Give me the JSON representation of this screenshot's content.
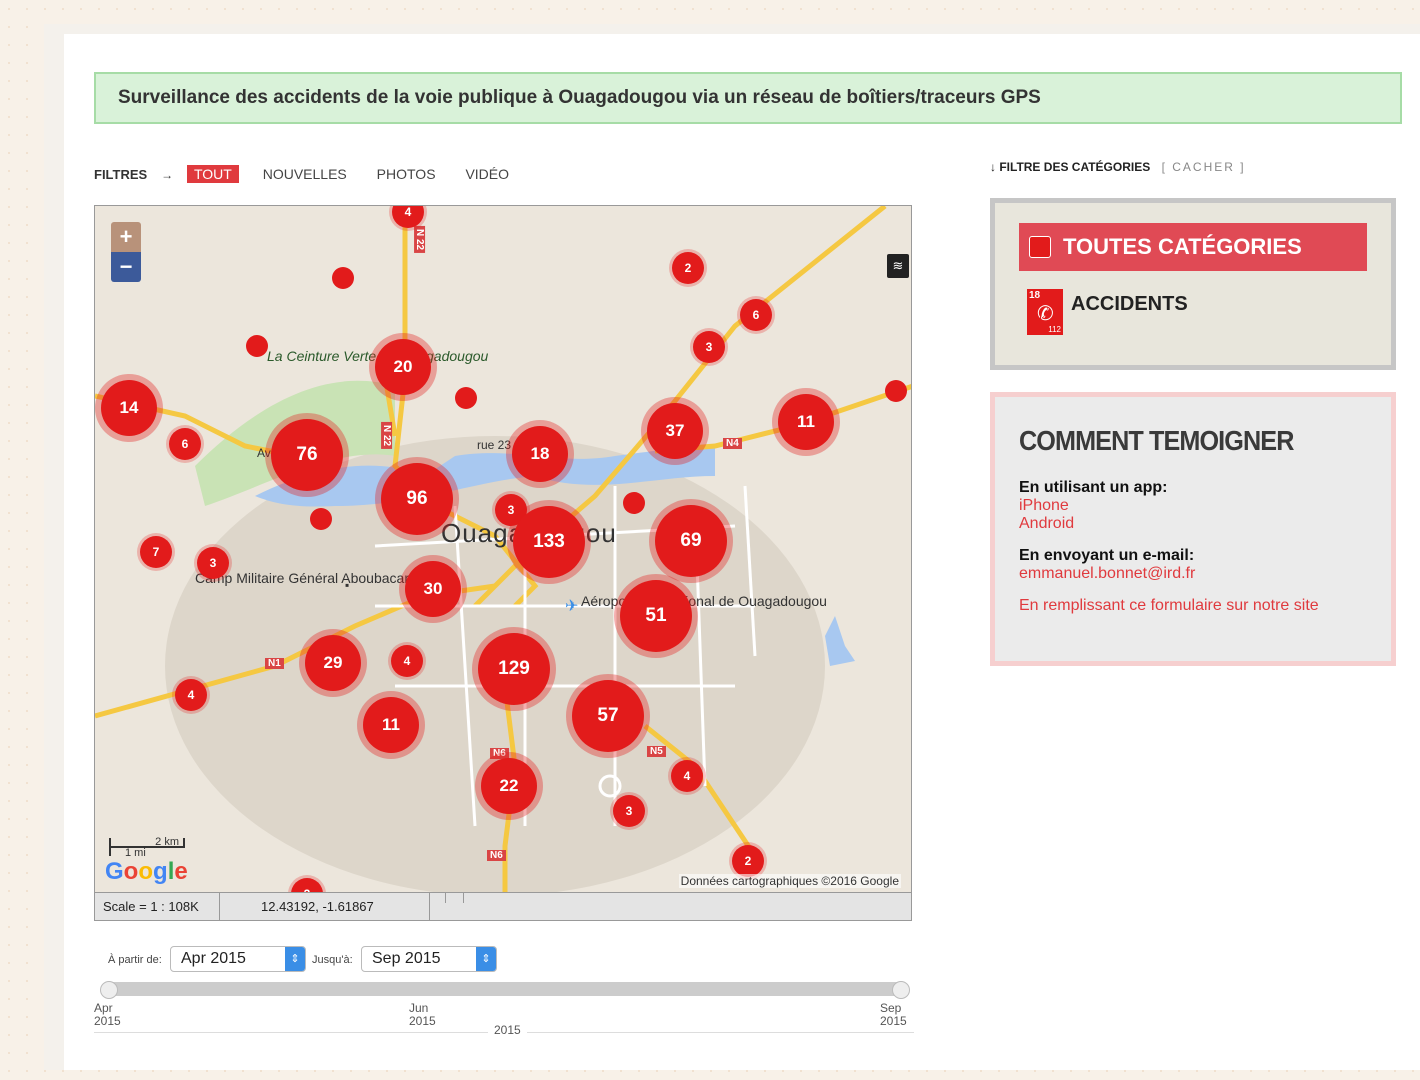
{
  "banner": {
    "text": "Surveillance des accidents de la voie publique à Ouagadougou via un réseau de boîtiers/traceurs GPS"
  },
  "filters": {
    "label": "FILTRES",
    "arrow": "→",
    "items": [
      "TOUT",
      "NOUVELLES",
      "PHOTOS",
      "VIDÉO"
    ],
    "active": "TOUT"
  },
  "map": {
    "zoom_in": "+",
    "zoom_out": "−",
    "labels": {
      "green_zone": "La Ceinture Verte de Ouagadougou",
      "city": "Ouagadougou",
      "camp": "Camp Militaire Général Aboubacar...",
      "airport": "Aéroport international de Ouagadougou",
      "rue": "rue 23",
      "avenue": "Avenue"
    },
    "road_shields": [
      "N 22",
      "N 22",
      "N1",
      "N4",
      "N5",
      "N6",
      "N6"
    ],
    "scale_km": "2 km",
    "scale_mi": "1 mi",
    "google_logo": "Google",
    "attribution": "Données cartographiques ©2016 Google",
    "clusters": [
      "4",
      "2",
      "6",
      "3",
      "20",
      "14",
      "6",
      "76",
      "96",
      "18",
      "3",
      "37",
      "11",
      "133",
      "69",
      "7",
      "3",
      "30",
      "51",
      "29",
      "4",
      "129",
      "4",
      "11",
      "57",
      "4",
      "22",
      "3",
      "2",
      "2"
    ]
  },
  "status": {
    "scale": "Scale = 1 : 108K",
    "coords": "12.43192, -1.61867"
  },
  "timeline": {
    "from_label": "À partir de:",
    "from_value": "Apr 2015",
    "to_label": "Jusqu'à:",
    "to_value": "Sep 2015",
    "ticks": [
      {
        "month": "Apr",
        "year": "2015"
      },
      {
        "month": "Jun",
        "year": "2015"
      },
      {
        "month": "Sep",
        "year": "2015"
      }
    ],
    "center_year": "2015"
  },
  "categories": {
    "header": "↓ FILTRE DES CATÉGORIES",
    "hide": "[ CACHER ]",
    "all": "TOUTES CATÉGORIES",
    "items": [
      {
        "label": "ACCIDENTS",
        "icon": "phone-18-112-icon"
      }
    ],
    "icon_text_top": "18",
    "icon_text_bottom": "112"
  },
  "testify": {
    "title": "COMMENT TEMOIGNER",
    "app_label": "En utilisant un app:",
    "iphone": "iPhone",
    "android": "Android",
    "email_label": "En envoyant un e-mail:",
    "email": "emmanuel.bonnet@ird.fr",
    "form": "En remplissant ce formulaire sur notre site"
  },
  "colors": {
    "accent": "#e21b1b",
    "banner_bg": "#d9f2d9",
    "link": "#e03a3e"
  }
}
